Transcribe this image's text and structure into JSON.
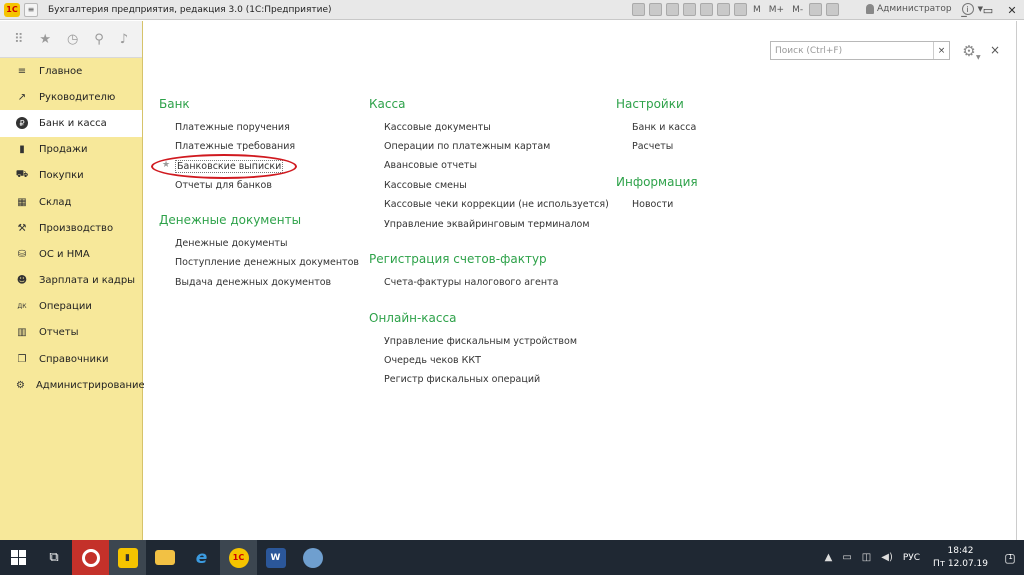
{
  "window": {
    "title": "Бухгалтерия предприятия, редакция 3.0  (1С:Предприятие)",
    "logo_text": "1С",
    "toolbar_m_labels": [
      "M",
      "M+",
      "M-"
    ],
    "user": "Администратор",
    "controls": [
      "_",
      "▭",
      "✕"
    ]
  },
  "sidebar": {
    "top_icons": [
      "apps-grid-icon",
      "star-icon",
      "history-icon",
      "search-icon",
      "bell-icon"
    ],
    "items": [
      {
        "label": "Главное",
        "icon": "≡"
      },
      {
        "label": "Руководителю",
        "icon": "↗"
      },
      {
        "label": "Банк и касса",
        "icon": "₽"
      },
      {
        "label": "Продажи",
        "icon": "▮"
      },
      {
        "label": "Покупки",
        "icon": "⛟"
      },
      {
        "label": "Склад",
        "icon": "▦"
      },
      {
        "label": "Производство",
        "icon": "⚒"
      },
      {
        "label": "ОС и НМА",
        "icon": "⛁"
      },
      {
        "label": "Зарплата и кадры",
        "icon": "☻"
      },
      {
        "label": "Операции",
        "icon": "ДК"
      },
      {
        "label": "Отчеты",
        "icon": "▥"
      },
      {
        "label": "Справочники",
        "icon": "❐"
      },
      {
        "label": "Администрирование",
        "icon": "⚙"
      }
    ],
    "active": "Банк и касса"
  },
  "search": {
    "placeholder": "Поиск (Ctrl+F)",
    "value": "",
    "clear": "×"
  },
  "main": {
    "close": "×",
    "gear": "⚙",
    "columns": {
      "bank": {
        "title": "Банк",
        "links": [
          "Платежные поручения",
          "Платежные требования",
          "Банковские выписки",
          "Отчеты для банков"
        ]
      },
      "money_docs": {
        "title": "Денежные документы",
        "links": [
          "Денежные документы",
          "Поступление денежных документов",
          "Выдача денежных документов"
        ]
      },
      "kassa": {
        "title": "Касса",
        "links": [
          "Кассовые документы",
          "Операции по платежным картам",
          "Авансовые отчеты",
          "Кассовые смены",
          "Кассовые чеки коррекции (не используется)",
          "Управление эквайринговым терминалом"
        ]
      },
      "invoices": {
        "title": "Регистрация счетов-фактур",
        "links": [
          "Счета-фактуры налогового агента"
        ]
      },
      "online_kassa": {
        "title": "Онлайн-касса",
        "links": [
          "Управление фискальным устройством",
          "Очередь чеков ККТ",
          "Регистр фискальных операций"
        ]
      },
      "settings": {
        "title": "Настройки",
        "links": [
          "Банк и касса",
          "Расчеты"
        ]
      },
      "info": {
        "title": "Информация",
        "links": [
          "Новости"
        ]
      }
    },
    "favorite_star": "★"
  },
  "taskbar": {
    "apps": [
      "opera",
      "1c-doc",
      "file-explorer",
      "internet-explorer",
      "1c",
      "word",
      "control-panel"
    ],
    "tray_lang": "РУС",
    "time": "18:42",
    "date": "Пт 12.07.19",
    "notif_count": "1"
  }
}
